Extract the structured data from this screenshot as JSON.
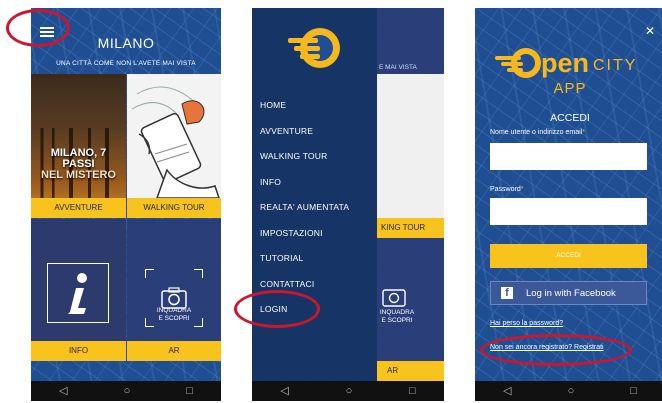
{
  "colors": {
    "accent_yellow": "#f7c31c",
    "map_blue": "#1f4f92",
    "facebook_blue": "#3b5998",
    "highlight_red": "#d0142a"
  },
  "screen_home": {
    "title": "MILANO",
    "subtitle": "UNA CITTÀ COME NON L'AVETE MAI VISTA",
    "menu_icon": "hamburger-menu-icon",
    "tiles": [
      {
        "label": "AVVENTURE",
        "image_text": [
          "MILANO, 7 PASSI",
          "NEL MISTERO"
        ]
      },
      {
        "label": "WALKING TOUR"
      },
      {
        "label": "INFO",
        "icon": "info-icon"
      },
      {
        "label": "AR",
        "icon": "camera-icon",
        "caption": [
          "INQUADRA",
          "E SCOPRI"
        ]
      }
    ]
  },
  "screen_menu": {
    "items": [
      "HOME",
      "AVVENTURE",
      "WALKING TOUR",
      "INFO",
      "REALTA' AUMENTATA",
      "IMPOSTAZIONI",
      "TUTORIAL",
      "CONTATTACI",
      "LOGIN"
    ],
    "behind": {
      "subtitle_fragment": "E MAI VISTA",
      "walk_label": "KING TOUR",
      "ar_caption": [
        "INQUADRA",
        "E SCOPRI"
      ],
      "ar_label": "AR"
    }
  },
  "screen_login": {
    "brand_open": "pen",
    "brand_city": "CITY",
    "brand_app": "APP",
    "heading": "ACCEDI",
    "username_label": "Nome utente o indirizzo email",
    "password_label": "Password",
    "required_mark": "*",
    "username_value": "",
    "password_value": "",
    "submit_label": "ACCEDI",
    "facebook_label": "Log in with Facebook",
    "forgot_link": "Hai perso la password?",
    "register_link": "Non sei ancora registrato? Registrati"
  },
  "navbar": {
    "back_glyph": "◁",
    "home_glyph": "○",
    "recent_glyph": "□"
  }
}
